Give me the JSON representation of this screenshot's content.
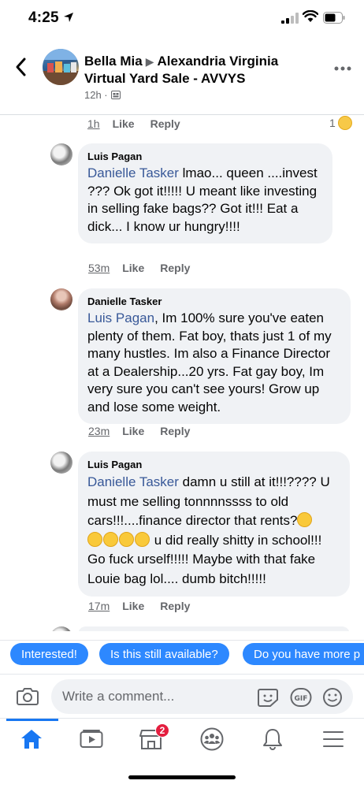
{
  "status_bar": {
    "time": "4:25"
  },
  "header": {
    "group_poster": "Bella Mia",
    "group_name": "Alexandria Virginia Virtual Yard Sale - AVVYS",
    "time": "12h ·"
  },
  "previous_comment_actions": {
    "time": "1h",
    "like": "Like",
    "reply": "Reply",
    "reaction_count": "1"
  },
  "comments": [
    {
      "author": "Luis Pagan",
      "mention": "Danielle Tasker",
      "text": " lmao... queen ....invest ??? Ok got it!!!!! U meant like investing in selling fake bags?? Got it!!! Eat a dick... I know ur hungry!!!!",
      "time": "53m",
      "like": "Like",
      "reply": "Reply"
    },
    {
      "author": "Danielle Tasker",
      "mention": "Luis Pagan",
      "text": ", Im 100% sure you've eaten plenty of them. Fat boy, thats just 1 of my many hustles. Im also a Finance Director at a Dealership...20 yrs. Fat gay boy, Im very sure you can't see yours! Grow up and lose some weight.",
      "time": "23m",
      "like": "Like",
      "reply": "Reply"
    },
    {
      "author": "Luis Pagan",
      "mention": "Danielle Tasker",
      "text_part1": " damn u still at it!!!???? U must me selling tonnnnssss to old cars!!!....finance director that rents?",
      "text_part2": " u did really shitty in school!!! Go fuck urself!!!!! Maybe with that fake Louie bag lol.... dumb bitch!!!!!",
      "time": "17m",
      "like": "Like",
      "reply": "Reply"
    }
  ],
  "quick_replies": [
    "Interested!",
    "Is this still available?",
    "Do you have more p"
  ],
  "composer": {
    "placeholder": "Write a comment..."
  },
  "tab_bar": {
    "marketplace_badge": "2"
  },
  "colors": {
    "accent": "#1877f2",
    "chip": "#2d88ff",
    "bubble": "#f0f2f5",
    "mention": "#385898",
    "badge": "#e41e3f"
  }
}
